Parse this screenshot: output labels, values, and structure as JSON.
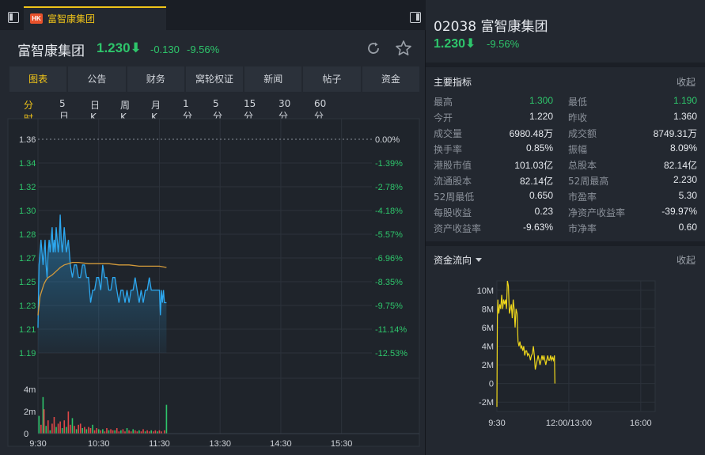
{
  "tab": {
    "badge": "HK",
    "title": "富智康集团"
  },
  "quote": {
    "name": "富智康集团",
    "price": "1.230",
    "change": "-0.130",
    "percent": "-9.56%"
  },
  "nav": [
    "图表",
    "公告",
    "财务",
    "窝轮权证",
    "新闻",
    "帖子",
    "资金"
  ],
  "periods": [
    "分时",
    "5日",
    "日K",
    "周K",
    "月K",
    "1分",
    "5分",
    "15分",
    "30分",
    "60分"
  ],
  "colors": {
    "up": "#2ec56b",
    "price_line": "#2da8f0",
    "avg_line": "#d39a3b",
    "accent": "#f0c419",
    "flow_line": "#f0d81c"
  },
  "chart_data": [
    {
      "type": "line",
      "title": "分时",
      "ylim": [
        1.19,
        1.36
      ],
      "y_ticks": [
        "1.36",
        "1.34",
        "1.32",
        "1.30",
        "1.28",
        "1.27",
        "1.25",
        "1.23",
        "1.21",
        "1.19"
      ],
      "pct_ticks": [
        "0.00%",
        "-1.39%",
        "-2.78%",
        "-4.18%",
        "-5.57%",
        "-6.96%",
        "-8.35%",
        "-9.75%",
        "-11.14%",
        "-12.53%"
      ],
      "x_ticks": [
        "9:30",
        "10:30",
        "11:30",
        "13:30",
        "14:30",
        "15:30"
      ],
      "x_minutes": [
        0,
        60,
        120,
        180,
        240,
        300
      ],
      "x_max": 330,
      "series": [
        {
          "name": "price",
          "x": [
            0,
            1,
            2,
            3,
            4,
            5,
            6,
            7,
            8,
            9,
            10,
            11,
            12,
            13,
            14,
            15,
            16,
            17,
            18,
            19,
            20,
            21,
            22,
            23,
            24,
            25,
            26,
            28,
            30,
            32,
            34,
            36,
            38,
            40,
            42,
            44,
            46,
            48,
            50,
            52,
            54,
            56,
            58,
            60,
            62,
            64,
            66,
            68,
            70,
            72,
            74,
            76,
            78,
            80,
            82,
            84,
            86,
            88,
            90,
            92,
            94,
            96,
            98,
            100,
            102,
            104,
            106,
            108,
            110,
            112,
            114,
            116,
            118,
            120,
            121,
            122,
            123,
            124,
            125,
            126,
            127
          ],
          "values": [
            1.21,
            1.26,
            1.27,
            1.28,
            1.27,
            1.26,
            1.27,
            1.28,
            1.26,
            1.25,
            1.27,
            1.28,
            1.27,
            1.28,
            1.29,
            1.27,
            1.28,
            1.27,
            1.29,
            1.28,
            1.27,
            1.28,
            1.3,
            1.28,
            1.27,
            1.28,
            1.29,
            1.27,
            1.28,
            1.26,
            1.25,
            1.26,
            1.26,
            1.25,
            1.25,
            1.26,
            1.26,
            1.25,
            1.25,
            1.23,
            1.24,
            1.24,
            1.25,
            1.25,
            1.24,
            1.26,
            1.25,
            1.25,
            1.24,
            1.24,
            1.25,
            1.25,
            1.24,
            1.23,
            1.24,
            1.24,
            1.23,
            1.24,
            1.23,
            1.24,
            1.24,
            1.25,
            1.24,
            1.23,
            1.24,
            1.23,
            1.24,
            1.24,
            1.25,
            1.24,
            1.24,
            1.24,
            1.24,
            1.24,
            1.22,
            1.24,
            1.23,
            1.24,
            1.23,
            1.23,
            1.23
          ]
        },
        {
          "name": "avg",
          "x": [
            0,
            2,
            4,
            6,
            8,
            10,
            14,
            18,
            22,
            26,
            30,
            34,
            40,
            50,
            60,
            70,
            80,
            90,
            100,
            110,
            120,
            127
          ],
          "values": [
            1.22,
            1.235,
            1.24,
            1.245,
            1.248,
            1.25,
            1.252,
            1.255,
            1.258,
            1.26,
            1.261,
            1.262,
            1.262,
            1.261,
            1.261,
            1.261,
            1.26,
            1.26,
            1.259,
            1.259,
            1.259,
            1.258
          ]
        }
      ]
    },
    {
      "type": "bar",
      "title": "成交量",
      "y_ticks": [
        "4m",
        "2m",
        "0"
      ],
      "ylim": [
        0,
        5
      ],
      "x": [
        1,
        3,
        5,
        6,
        8,
        10,
        12,
        14,
        16,
        18,
        20,
        22,
        24,
        26,
        28,
        30,
        32,
        34,
        36,
        38,
        40,
        42,
        44,
        46,
        48,
        50,
        52,
        54,
        56,
        58,
        60,
        62,
        64,
        66,
        68,
        70,
        72,
        74,
        76,
        78,
        80,
        82,
        84,
        86,
        88,
        90,
        92,
        94,
        96,
        98,
        100,
        102,
        104,
        106,
        108,
        110,
        112,
        114,
        116,
        118,
        120,
        122,
        125,
        127
      ],
      "values": [
        1.6,
        0.8,
        3.3,
        2.2,
        0.7,
        1.2,
        0.3,
        0.9,
        1.5,
        0.6,
        0.9,
        1.1,
        0.5,
        1.2,
        0.6,
        2.0,
        0.8,
        1.4,
        0.7,
        0.4,
        0.8,
        0.9,
        0.5,
        0.6,
        0.4,
        0.6,
        0.5,
        0.8,
        0.3,
        0.5,
        0.4,
        0.3,
        0.4,
        0.2,
        0.5,
        0.3,
        0.4,
        0.3,
        0.3,
        0.5,
        0.2,
        0.3,
        0.4,
        0.2,
        0.5,
        0.3,
        0.2,
        0.4,
        0.3,
        0.2,
        0.3,
        0.2,
        0.4,
        0.2,
        0.3,
        0.2,
        0.3,
        0.2,
        0.3,
        0.2,
        0.3,
        0.2,
        0.3,
        2.6
      ],
      "direction": [
        "g",
        "r",
        "g",
        "r",
        "g",
        "r",
        "g",
        "r",
        "r",
        "g",
        "r",
        "r",
        "g",
        "r",
        "g",
        "r",
        "r",
        "g",
        "r",
        "g",
        "r",
        "r",
        "g",
        "r",
        "g",
        "r",
        "r",
        "g",
        "r",
        "r",
        "g",
        "r",
        "g",
        "r",
        "r",
        "g",
        "r",
        "r",
        "g",
        "r",
        "r",
        "g",
        "r",
        "r",
        "g",
        "r",
        "r",
        "g",
        "r",
        "r",
        "g",
        "r",
        "r",
        "g",
        "r",
        "r",
        "g",
        "r",
        "r",
        "g",
        "r",
        "r",
        "r",
        "g"
      ]
    },
    {
      "type": "line",
      "title": "资金流向",
      "y_ticks": [
        "10M",
        "8M",
        "6M",
        "4M",
        "2M",
        "0",
        "-2M"
      ],
      "ylim": [
        -3,
        11
      ],
      "x_ticks": [
        "9:30",
        "12:00/13:00",
        "16:00"
      ],
      "x_minutes": [
        0,
        150,
        300
      ],
      "x_max": 330,
      "series": [
        {
          "name": "flow",
          "x": [
            0,
            1,
            2,
            3,
            4,
            6,
            8,
            10,
            12,
            14,
            16,
            18,
            20,
            22,
            24,
            26,
            28,
            30,
            32,
            34,
            36,
            38,
            40,
            42,
            44,
            46,
            48,
            50,
            52,
            54,
            56,
            58,
            60,
            62,
            64,
            66,
            68,
            70,
            72,
            74,
            76,
            78,
            80,
            82,
            84,
            86,
            88,
            90,
            92,
            94,
            96,
            98,
            100,
            102,
            104,
            106,
            108,
            110,
            112,
            114,
            116,
            118,
            120,
            121
          ],
          "values": [
            -2.5,
            7.0,
            9.0,
            8.0,
            7.5,
            8.5,
            8.0,
            9.5,
            8.0,
            9.0,
            8.5,
            9.0,
            8.0,
            11.0,
            10.5,
            7.5,
            8.0,
            8.5,
            7.0,
            9.0,
            8.0,
            6.0,
            8.0,
            7.5,
            4.5,
            4.0,
            4.5,
            3.8,
            4.0,
            3.5,
            4.0,
            3.0,
            3.5,
            3.5,
            3.0,
            3.2,
            3.0,
            2.5,
            3.0,
            3.2,
            4.0,
            3.0,
            1.5,
            2.0,
            2.5,
            3.0,
            2.5,
            2.0,
            2.5,
            3.0,
            2.5,
            3.0,
            2.5,
            2.0,
            2.5,
            3.0,
            2.5,
            2.5,
            3.0,
            2.5,
            2.8,
            2.5,
            3.0,
            0.0
          ]
        }
      ]
    }
  ],
  "right": {
    "code_name": "02038 富智康集团",
    "price": "1.230",
    "percent": "-9.56%",
    "indicators_title": "主要指标",
    "collapse": "收起",
    "flow_title": "资金流向",
    "indicators": [
      [
        "最高",
        "1.300",
        "最低",
        "1.190"
      ],
      [
        "今开",
        "1.220",
        "昨收",
        "1.360"
      ],
      [
        "成交量",
        "6980.48万",
        "成交额",
        "8749.31万"
      ],
      [
        "换手率",
        "0.85%",
        "振幅",
        "8.09%"
      ],
      [
        "港股市值",
        "101.03亿",
        "总股本",
        "82.14亿"
      ],
      [
        "流通股本",
        "82.14亿",
        "52周最高",
        "2.230"
      ],
      [
        "52周最低",
        "0.650",
        "市盈率",
        "5.30"
      ],
      [
        "每股收益",
        "0.23",
        "净资产收益率",
        "-39.97%"
      ],
      [
        "资产收益率",
        "-9.63%",
        "市净率",
        "0.60"
      ]
    ]
  }
}
